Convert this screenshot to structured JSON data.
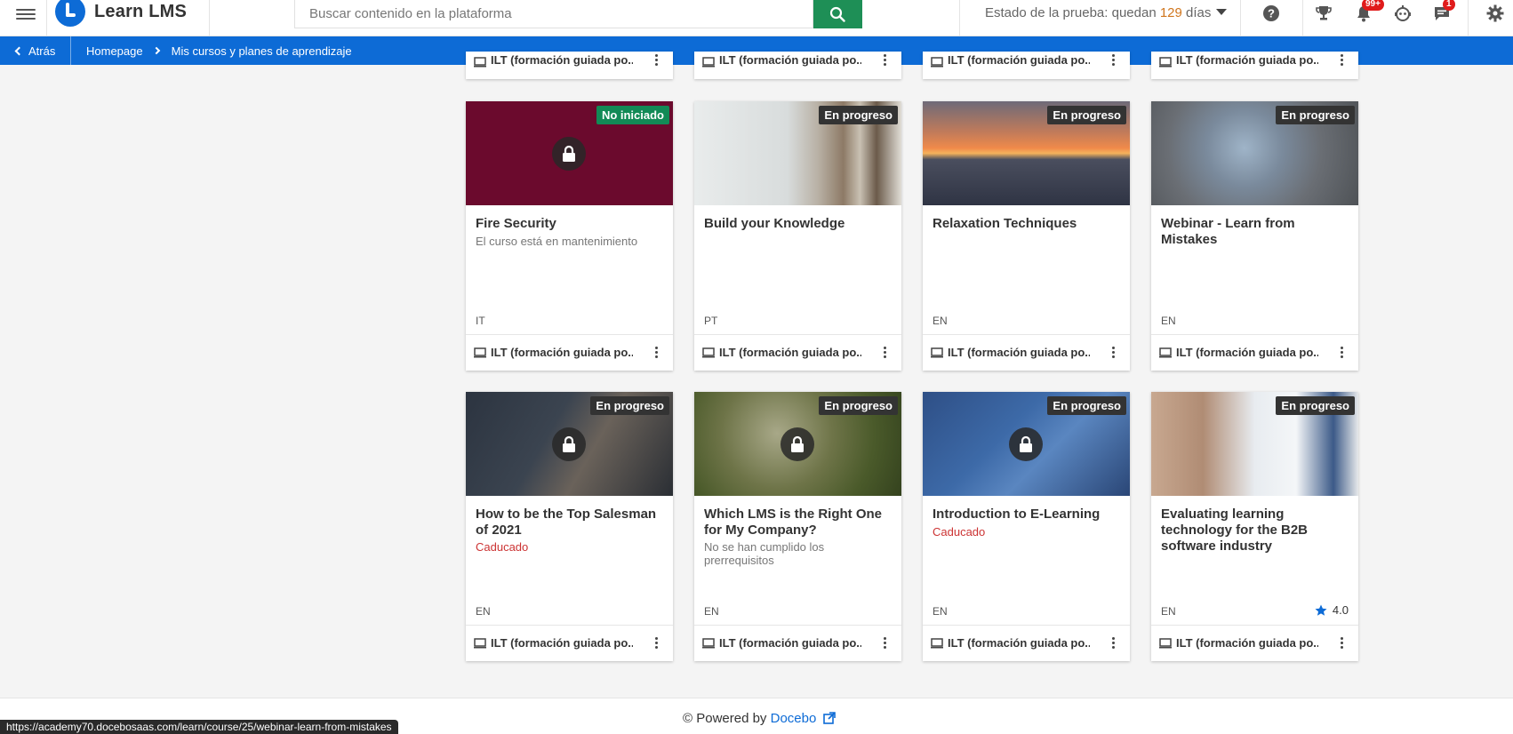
{
  "app": {
    "name": "Learn LMS"
  },
  "search": {
    "placeholder": "Buscar contenido en la plataforma"
  },
  "trial": {
    "prefix": "Estado de la prueba: quedan ",
    "days": "129",
    "suffix": " días"
  },
  "badges": {
    "notifications": "99+",
    "messages": "1"
  },
  "icons": [
    "menu-icon",
    "search-icon",
    "help-icon",
    "trophy-icon",
    "bell-icon",
    "robot-icon",
    "chat-icon",
    "gear-icon",
    "lock-icon",
    "monitor-icon",
    "more-vertical-icon",
    "star-icon",
    "external-link-icon"
  ],
  "nav": {
    "back_label": "Atrás",
    "breadcrumbs": [
      "Homepage",
      "Mis cursos y planes de aprendizaje"
    ]
  },
  "colors": {
    "brand_blue": "#0d6bd6",
    "search_green": "#1e8f56",
    "not_started_green": "#128a56",
    "badge_red": "#e01b1b",
    "expired_red": "#cc3333",
    "trial_days_orange": "#d0761e"
  },
  "top_row_partial_type": "ILT (formación guiada po...",
  "courses": [
    {
      "title": "Fire Security",
      "subtitle": "El curso está en mantenimiento",
      "status": "No iniciado",
      "lang": "IT",
      "type": "ILT (formación guiada po...",
      "locked": true
    },
    {
      "title": "Build your Knowledge",
      "subtitle": "",
      "status": "En progreso",
      "lang": "PT",
      "type": "ILT (formación guiada po...",
      "locked": false
    },
    {
      "title": "Relaxation Techniques",
      "subtitle": "",
      "status": "En progreso",
      "lang": "EN",
      "type": "ILT (formación guiada po...",
      "locked": false
    },
    {
      "title": "Webinar - Learn from Mistakes",
      "subtitle": "",
      "status": "En progreso",
      "lang": "EN",
      "type": "ILT (formación guiada po...",
      "locked": false
    },
    {
      "title": "How to be the Top Salesman of 2021",
      "subtitle": "Caducado",
      "status": "En progreso",
      "lang": "EN",
      "type": "ILT (formación guiada po...",
      "locked": true
    },
    {
      "title": "Which LMS is the Right One for My Company?",
      "subtitle": "No se han cumplido los prerrequisitos",
      "status": "En progreso",
      "lang": "EN",
      "type": "ILT (formación guiada po...",
      "locked": true
    },
    {
      "title": "Introduction to E-Learning",
      "subtitle": "Caducado",
      "status": "En progreso",
      "lang": "EN",
      "type": "ILT (formación guiada po...",
      "locked": true
    },
    {
      "title": "Evaluating learning technology for the B2B software industry",
      "subtitle": "",
      "status": "En progreso",
      "lang": "EN",
      "type": "ILT (formación guiada po...",
      "locked": false,
      "rating": "4.0"
    }
  ],
  "footer": {
    "powered_by": "© Powered by ",
    "brand": "Docebo"
  },
  "status_url": "https://academy70.docebosaas.com/learn/course/25/webinar-learn-from-mistakes"
}
